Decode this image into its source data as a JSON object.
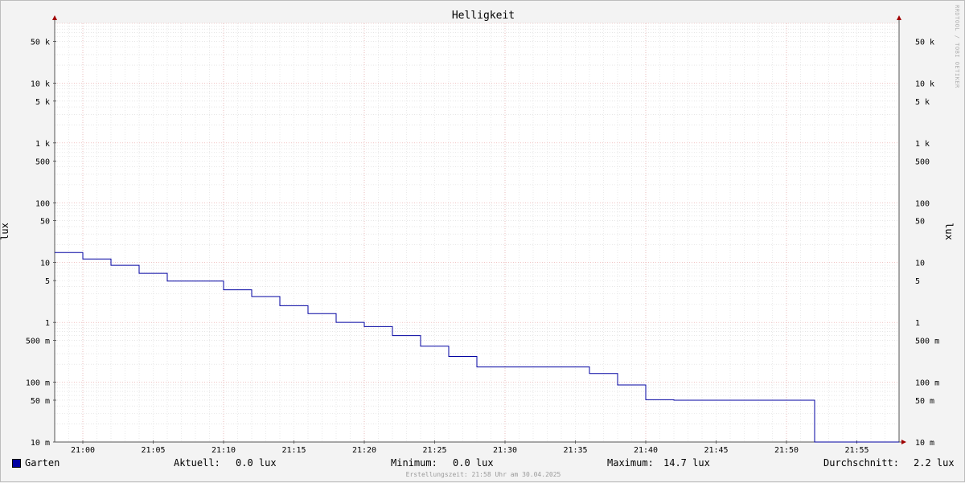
{
  "chart_data": {
    "type": "line",
    "title": "Helligkeit",
    "ylabel": "lux",
    "yscale": "log",
    "ylim": [
      0.01,
      100000
    ],
    "xlim": [
      "20:58",
      "21:58"
    ],
    "x_ticks": [
      "21:00",
      "21:05",
      "21:10",
      "21:15",
      "21:20",
      "21:25",
      "21:30",
      "21:35",
      "21:40",
      "21:45",
      "21:50",
      "21:55"
    ],
    "y_ticks": [
      {
        "value": 50000,
        "label": "50 k"
      },
      {
        "value": 10000,
        "label": "10 k"
      },
      {
        "value": 5000,
        "label": "5 k"
      },
      {
        "value": 1000,
        "label": "1 k"
      },
      {
        "value": 500,
        "label": "500"
      },
      {
        "value": 100,
        "label": "100"
      },
      {
        "value": 50,
        "label": "50"
      },
      {
        "value": 10,
        "label": "10"
      },
      {
        "value": 5,
        "label": "5"
      },
      {
        "value": 1,
        "label": "1"
      },
      {
        "value": 0.5,
        "label": "500 m"
      },
      {
        "value": 0.1,
        "label": "100 m"
      },
      {
        "value": 0.05,
        "label": "50 m"
      },
      {
        "value": 0.01,
        "label": "10 m"
      }
    ],
    "grid": true,
    "series": [
      {
        "name": "Garten",
        "color": "#0000a0",
        "points": [
          {
            "x": "20:58",
            "y": 14.7
          },
          {
            "x": "21:00",
            "y": 11.5
          },
          {
            "x": "21:02",
            "y": 9.0
          },
          {
            "x": "21:04",
            "y": 6.6
          },
          {
            "x": "21:06",
            "y": 4.9
          },
          {
            "x": "21:10",
            "y": 3.5
          },
          {
            "x": "21:12",
            "y": 2.7
          },
          {
            "x": "21:14",
            "y": 1.9
          },
          {
            "x": "21:16",
            "y": 1.4
          },
          {
            "x": "21:18",
            "y": 1.0
          },
          {
            "x": "21:20",
            "y": 0.85
          },
          {
            "x": "21:22",
            "y": 0.6
          },
          {
            "x": "21:24",
            "y": 0.4
          },
          {
            "x": "21:26",
            "y": 0.27
          },
          {
            "x": "21:28",
            "y": 0.18
          },
          {
            "x": "21:36",
            "y": 0.14
          },
          {
            "x": "21:38",
            "y": 0.09
          },
          {
            "x": "21:40",
            "y": 0.051
          },
          {
            "x": "21:42",
            "y": 0.05
          },
          {
            "x": "21:52",
            "y": 0.0
          },
          {
            "x": "21:58",
            "y": 0.0
          }
        ]
      }
    ]
  },
  "legend": {
    "series_name": "Garten",
    "aktuell_label": "Aktuell:",
    "aktuell_value": "0.0 lux",
    "minimum_label": "Minimum:",
    "minimum_value": "0.0 lux",
    "maximum_label": "Maximum:",
    "maximum_value": "14.7 lux",
    "durchschnitt_label": "Durchschnitt:",
    "durchschnitt_value": "2.2 lux"
  },
  "footer": "Erstellungszeit: 21:58 Uhr am 30.04.2025",
  "watermark": "RRDTOOL / TOBI OETIKER"
}
